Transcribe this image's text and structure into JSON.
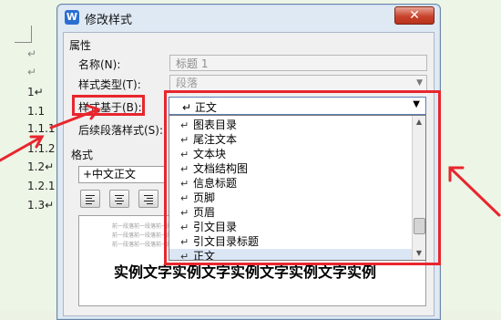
{
  "document": {
    "paragraph_mark": "↵",
    "lines": [
      "1↵",
      "1.1",
      "1.1.1",
      "1.1.2",
      "1.2↵",
      "1.2.1",
      "1.3↵"
    ]
  },
  "dialog": {
    "title": "修改样式",
    "app_icon_letter": "W",
    "close_glyph": "✕",
    "properties_label": "属性",
    "name_label": "名称(N):",
    "name_value": "标题 1",
    "style_type_label": "样式类型(T):",
    "style_type_value": "段落",
    "based_on_label": "样式基于(B):",
    "next_style_label": "后续段落样式(S):",
    "format_label": "格式",
    "font_value": "+中文正文",
    "preview_big_text": "实例文字实例文字实例文字实例文字实例",
    "preview_small_text": "前一段落前一段落前一段落前一段落前一段落前一段落前一段落前一段落前一段落"
  },
  "dropdown": {
    "selected_value": "正文",
    "items": [
      "图表目录",
      "尾注文本",
      "文本块",
      "文档结构图",
      "信息标题",
      "页脚",
      "页眉",
      "引文目录",
      "引文目录标题",
      "正文"
    ]
  },
  "colors": {
    "highlight": "#e8262e",
    "accent": "#2b6ed1"
  }
}
